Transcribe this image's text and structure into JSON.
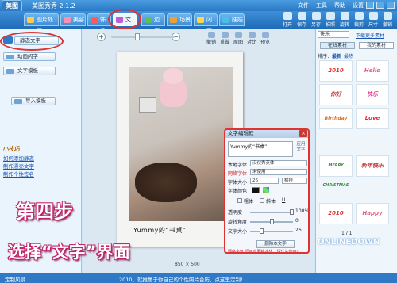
{
  "app": {
    "logo": "美图",
    "title": "美图秀秀 2.1.2"
  },
  "menu": [
    "文件",
    "工具",
    "帮助",
    "设置"
  ],
  "tabs": [
    {
      "label": "图片处理"
    },
    {
      "label": "美容"
    },
    {
      "label": "饰品"
    },
    {
      "label": "文字",
      "active": true
    },
    {
      "label": "边框"
    },
    {
      "label": "场景"
    },
    {
      "label": "闪图"
    },
    {
      "label": "娃娃"
    }
  ],
  "toolbar": [
    "打开",
    "保存",
    "另存",
    "拍照",
    "旋转",
    "裁剪",
    "尺寸",
    "撤销"
  ],
  "sidebar": {
    "static_text": "静态文字",
    "animated_text": "动画闪字",
    "text_template": "文字模板",
    "import_template": "导入模板",
    "tips_title": "小技巧",
    "tips": [
      "如何添加静态",
      "制作漂亮文字",
      "制作个性签名"
    ]
  },
  "canvas": {
    "actions": [
      "撤销",
      "重做",
      "原图",
      "对比",
      "预览"
    ],
    "caption": "Yummy的“书桌”",
    "footer": "850 × 500"
  },
  "dialog": {
    "title": "文字编辑框",
    "text": "Yummy的“书桌”",
    "apply": "应用文字",
    "font_label": "本地字体",
    "font_value": "汉仪秀英体",
    "net_font_label": "网络字体",
    "net_font_value": "未使用",
    "size_label": "字体大小",
    "size_value": "26",
    "style_value": "横排",
    "color_label": "字体颜色",
    "bold": "粗体",
    "italic": "斜体",
    "underline": "U",
    "opacity_label": "透明度",
    "opacity_value": "100%",
    "rotate_label": "旋转角度",
    "rotate_value": "0",
    "textsize_label": "文字大小",
    "textsize_value": "26",
    "delete": "删除本文字",
    "footer": "网络字体 调用自网络字体，请优先使用！"
  },
  "right_panel": {
    "tab1": "快乐",
    "tab2": "下载更多素材",
    "sub1": "在线素材",
    "sub2": "我的素材",
    "sort": "排序：",
    "sort_new": "最新",
    "sort_hot": "最热",
    "tiles": [
      "2010",
      "Hello",
      "你好",
      "快乐",
      "Birthday",
      "Love",
      "MERRY CHRISTMAS",
      "新年快乐",
      "2010",
      "Happy"
    ],
    "pager": "1 / 1"
  },
  "overlay": {
    "step": "第四步",
    "select": "选择“文字”界面"
  },
  "status": {
    "text1": "定制风景",
    "text2": "2010，就推属于你自己的个性照片台历，点这里定制!"
  },
  "watermark": "ONLINEDOWN",
  "colors": {
    "accent": "#2f79c7",
    "highlight": "#d33333",
    "overlay": "#c0226a"
  }
}
